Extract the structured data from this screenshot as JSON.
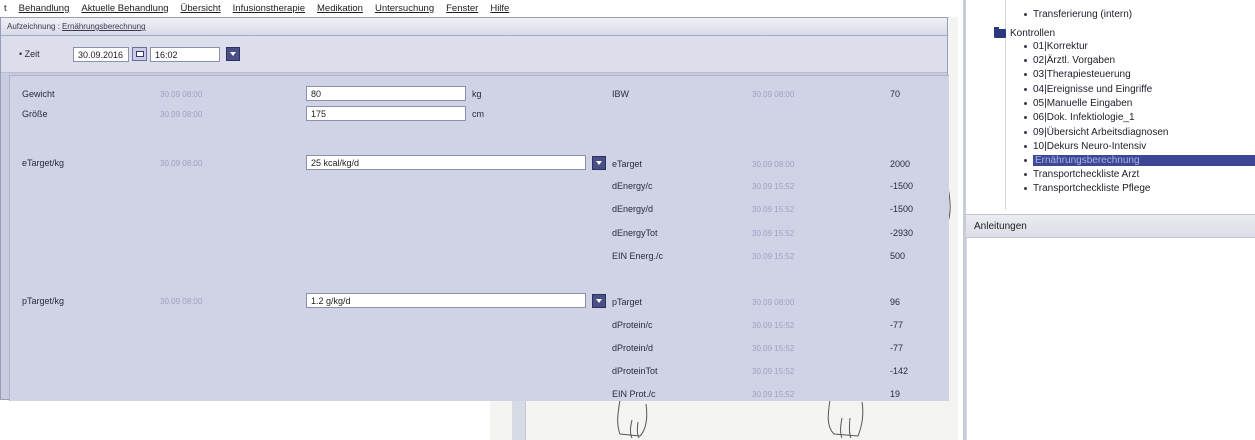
{
  "menu": {
    "items": [
      "t",
      "Behandlung",
      "Aktuelle Behandlung",
      "Übersicht",
      "Infusionstherapie",
      "Medikation",
      "Untersuchung",
      "Fenster",
      "Hilfe"
    ]
  },
  "dialog": {
    "title_prefix": "Aufzeichnung :",
    "title_name": "Ernährungsberechnung",
    "time_label": "• Zeit",
    "date_value": "30.09.2016",
    "time_value": "16:02"
  },
  "left_rows": [
    {
      "label": "Gewicht",
      "timestamp": "30.09 08:00",
      "value": "80",
      "unit": "kg"
    },
    {
      "label": "Größe",
      "timestamp": "30.09 08:00",
      "value": "175",
      "unit": "cm"
    },
    {
      "label": "eTarget/kg",
      "timestamp": "30.09 08:00",
      "value": "25 kcal/kg/d",
      "unit": ""
    },
    {
      "label": "pTarget/kg",
      "timestamp": "30.09 08:00",
      "value": "1.2 g/kg/d",
      "unit": ""
    }
  ],
  "right_rows": [
    {
      "label": "IBW",
      "timestamp": "30.09 08:00",
      "value": "70"
    },
    {
      "label": "eTarget",
      "timestamp": "30.09 08:00",
      "value": "2000"
    },
    {
      "label": "dEnergy/c",
      "timestamp": "30.09 15:52",
      "value": "-1500"
    },
    {
      "label": "dEnergy/d",
      "timestamp": "30.09 15:52",
      "value": "-1500"
    },
    {
      "label": "dEnergyTot",
      "timestamp": "30.09 15:52",
      "value": "-2930"
    },
    {
      "label": "EIN Energ./c",
      "timestamp": "30.09 15:52",
      "value": "500"
    },
    {
      "label": "pTarget",
      "timestamp": "30.09 08:00",
      "value": "96"
    },
    {
      "label": "dProtein/c",
      "timestamp": "30.09 15:52",
      "value": "-77"
    },
    {
      "label": "dProtein/d",
      "timestamp": "30.09 15:52",
      "value": "-77"
    },
    {
      "label": "dProteinTot",
      "timestamp": "30.09 15:52",
      "value": "-142"
    },
    {
      "label": "EIN Prot./c",
      "timestamp": "30.09 15:52",
      "value": "19"
    }
  ],
  "tree": {
    "top_item": "Transferierung (intern)",
    "folder": "Kontrollen",
    "items": [
      "01|Korrektur",
      "02|Ärztl. Vorgaben",
      "03|Therapiesteuerung",
      "04|Ereignisse und Eingriffe",
      "05|Manuelle Eingaben",
      "06|Dok. Infektiologie_1",
      "09|Übersicht Arbeitsdiagnosen",
      "10|Dekurs Neuro-Intensiv",
      "Ernährungsberechnung",
      "Transportcheckliste Arzt",
      "Transportcheckliste Pflege"
    ],
    "selected_index": 8
  },
  "anleitungen": "Anleitungen",
  "colors": {
    "selection": "#3d4796",
    "dialog_bg": "#c9ccdf",
    "dropdown_button": "#4a4f86"
  }
}
